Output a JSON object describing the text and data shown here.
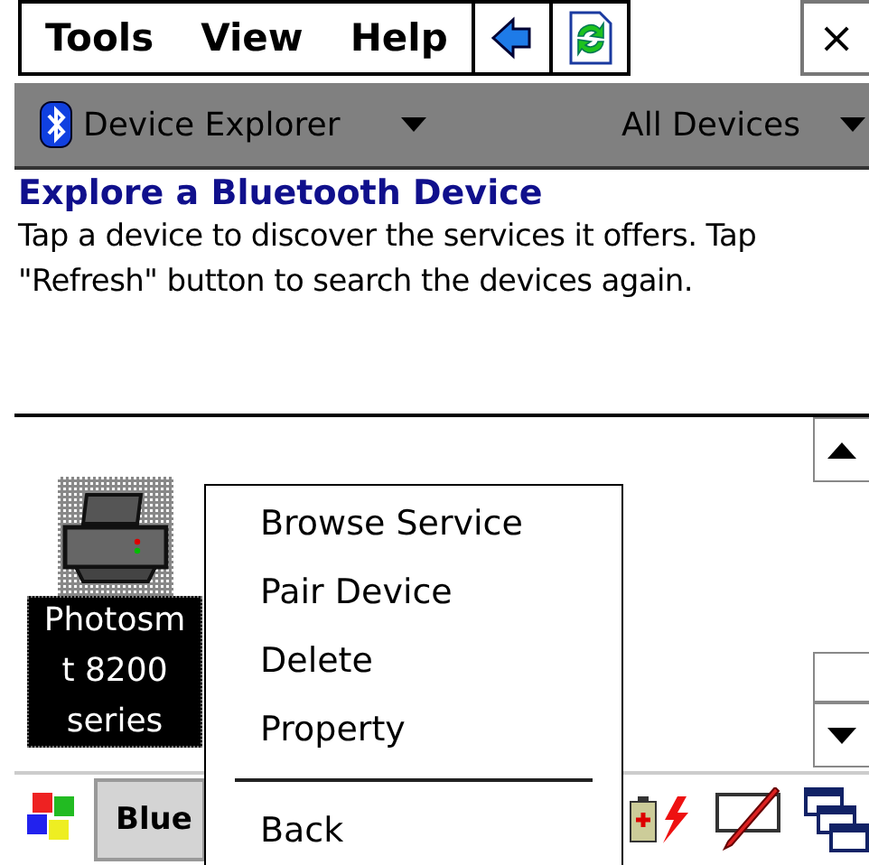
{
  "menu_bar": {
    "items": [
      {
        "label": "Tools"
      },
      {
        "label": "View"
      },
      {
        "label": "Help"
      }
    ],
    "close": "×"
  },
  "nav_bar": {
    "title": "Device Explorer",
    "filter": "All Devices"
  },
  "header": {
    "title": "Explore a Bluetooth Device",
    "description": "Tap a device to discover the services it offers. Tap \"Refresh\" button to search the devices again."
  },
  "devices": [
    {
      "label_lines": [
        "Photosm",
        "t 8200",
        "series"
      ],
      "selected": true
    }
  ],
  "context_menu": {
    "items": [
      {
        "kind": "item",
        "label": "Browse Service"
      },
      {
        "kind": "item",
        "label": "Pair Device"
      },
      {
        "kind": "item",
        "label": "Delete"
      },
      {
        "kind": "item",
        "label": "Property"
      },
      {
        "kind": "separator"
      },
      {
        "kind": "item",
        "label": "Back"
      }
    ]
  },
  "taskbar": {
    "app_button": "Blue"
  }
}
